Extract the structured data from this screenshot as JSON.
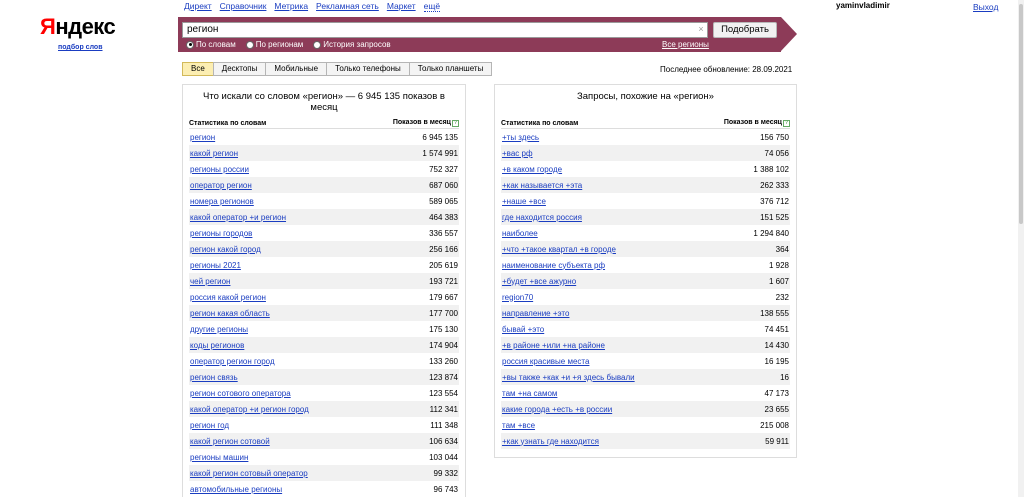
{
  "logo": {
    "text_first": "Я",
    "text_rest": "ндекс",
    "subtitle": "подбор слов"
  },
  "topnav": [
    "Директ",
    "Справочник",
    "Метрика",
    "Рекламная сеть",
    "Маркет",
    "ещё"
  ],
  "user": {
    "name": "yaminvladimir",
    "logout": "Выход"
  },
  "search": {
    "value": "регион",
    "submit": "Подобрать",
    "clear_icon": "×"
  },
  "radios": [
    {
      "label": "По словам",
      "checked": true
    },
    {
      "label": "По регионам",
      "checked": false
    },
    {
      "label": "История запросов",
      "checked": false
    }
  ],
  "all_regions": "Все регионы",
  "tabs": [
    "Все",
    "Десктопы",
    "Мобильные",
    "Только телефоны",
    "Только планшеты"
  ],
  "updated": "Последнее обновление: 28.09.2021",
  "left": {
    "title": "Что искали со словом «регион» — 6 945 135 показов в месяц",
    "col_word": "Статистика по словам",
    "col_count": "Показов в месяц",
    "help": "?",
    "rows": [
      {
        "q": "регион",
        "n": "6 945 135"
      },
      {
        "q": "какой регион",
        "n": "1 574 991"
      },
      {
        "q": "регионы россии",
        "n": "752 327"
      },
      {
        "q": "оператор регион",
        "n": "687 060"
      },
      {
        "q": "номера регионов",
        "n": "589 065"
      },
      {
        "q": "какой оператор +и регион",
        "n": "464 383"
      },
      {
        "q": "регионы городов",
        "n": "336 557"
      },
      {
        "q": "регион какой город",
        "n": "256 166"
      },
      {
        "q": "регионы 2021",
        "n": "205 619"
      },
      {
        "q": "чей регион",
        "n": "193 721"
      },
      {
        "q": "россия какой регион",
        "n": "179 667"
      },
      {
        "q": "регион какая область",
        "n": "177 700"
      },
      {
        "q": "другие регионы",
        "n": "175 130"
      },
      {
        "q": "коды регионов",
        "n": "174 904"
      },
      {
        "q": "оператор регион город",
        "n": "133 260"
      },
      {
        "q": "регион связь",
        "n": "123 874"
      },
      {
        "q": "регион сотового оператора",
        "n": "123 554"
      },
      {
        "q": "какой оператор +и регион город",
        "n": "112 341"
      },
      {
        "q": "регион год",
        "n": "111 348"
      },
      {
        "q": "какой регион сотовой",
        "n": "106 634"
      },
      {
        "q": "регионы машин",
        "n": "103 044"
      },
      {
        "q": "какой регион сотовый оператор",
        "n": "99 332"
      },
      {
        "q": "автомобильные регионы",
        "n": "96 743"
      }
    ]
  },
  "right": {
    "title": "Запросы, похожие на «регион»",
    "col_word": "Статистика по словам",
    "col_count": "Показов в месяц",
    "help": "?",
    "rows": [
      {
        "q": "+ты здесь",
        "n": "156 750"
      },
      {
        "q": "+вас рф",
        "n": "74 056"
      },
      {
        "q": "+в каком городе",
        "n": "1 388 102"
      },
      {
        "q": "+как называется +эта",
        "n": "262 333"
      },
      {
        "q": "+наше +все",
        "n": "376 712"
      },
      {
        "q": "где находится россия",
        "n": "151 525"
      },
      {
        "q": "наиболее",
        "n": "1 294 840"
      },
      {
        "q": "+что +такое квартал +в городе",
        "n": "364"
      },
      {
        "q": "наименование субъекта рф",
        "n": "1 928"
      },
      {
        "q": "+будет +все ажурно",
        "n": "1 607"
      },
      {
        "q": "region70",
        "n": "232"
      },
      {
        "q": "направление +это",
        "n": "138 555"
      },
      {
        "q": "бывай +это",
        "n": "74 451"
      },
      {
        "q": "+в районе +или +на районе",
        "n": "14 430"
      },
      {
        "q": "россия красивые места",
        "n": "16 195"
      },
      {
        "q": "+вы также +как +и +я здесь бывали",
        "n": "16"
      },
      {
        "q": "там +на самом",
        "n": "47 173"
      },
      {
        "q": "какие города +есть +в россии",
        "n": "23 655"
      },
      {
        "q": "там +все",
        "n": "215 008"
      },
      {
        "q": "+как узнать где находится",
        "n": "59 911"
      }
    ]
  },
  "colors": {
    "band": "#8d3b58",
    "link": "#1a3dc1",
    "logo_red": "#ff0000",
    "active_tab": "#fceeb2"
  }
}
